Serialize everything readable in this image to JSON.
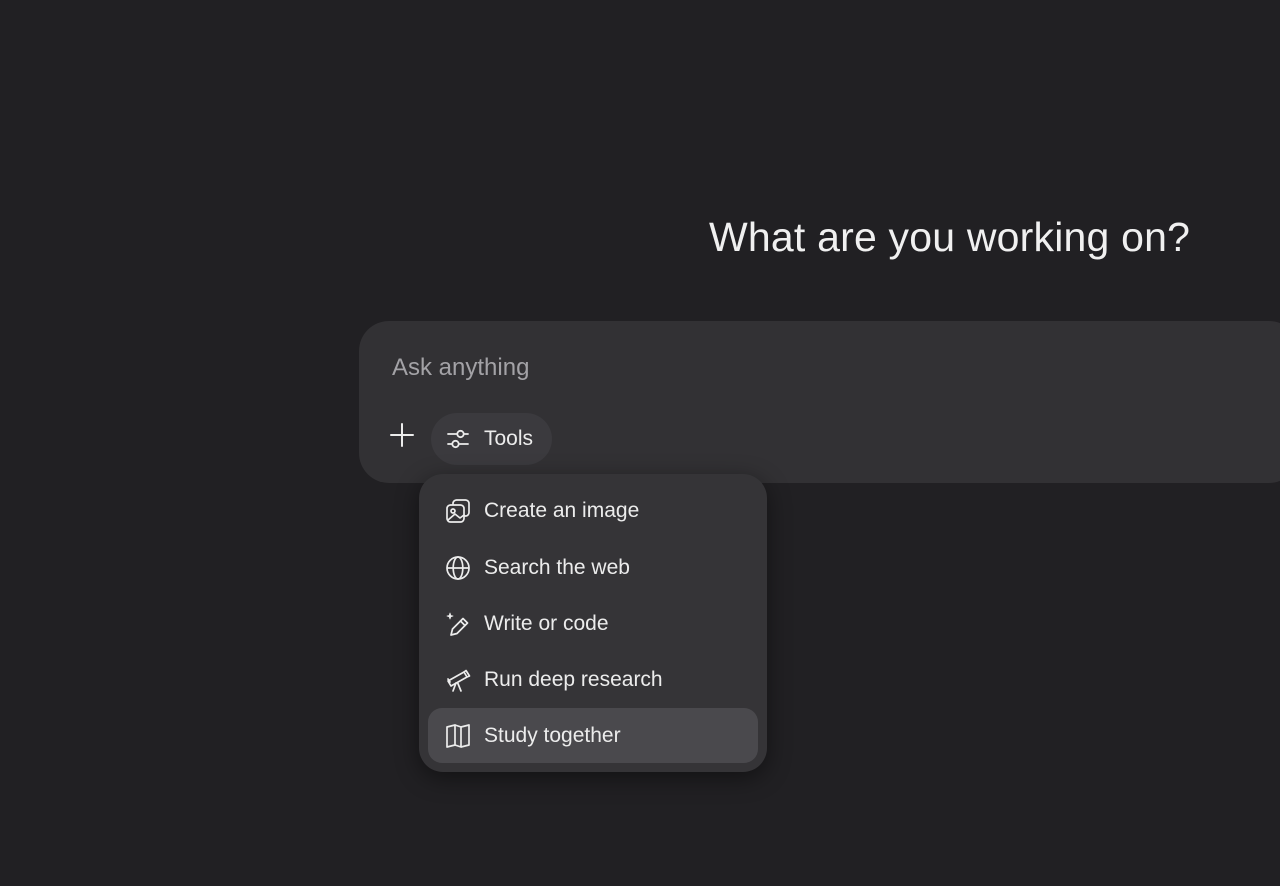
{
  "headline": "What are you working on?",
  "composer": {
    "placeholder": "Ask anything",
    "plus_icon": "plus-icon",
    "tools_label": "Tools",
    "tools_icon": "sliders-icon"
  },
  "tools_menu": {
    "items": [
      {
        "label": "Create an image",
        "icon": "image-icon"
      },
      {
        "label": "Search the web",
        "icon": "globe-icon"
      },
      {
        "label": "Write or code",
        "icon": "pencil-sparkle-icon"
      },
      {
        "label": "Run deep research",
        "icon": "telescope-icon"
      },
      {
        "label": "Study together",
        "icon": "open-book-icon",
        "highlighted": true
      }
    ]
  },
  "colors": {
    "background": "#212023",
    "composer": "#323134",
    "menu": "#353437",
    "menu_highlight": "#4a494d",
    "text": "#ececec",
    "placeholder": "#a3a2a6"
  }
}
